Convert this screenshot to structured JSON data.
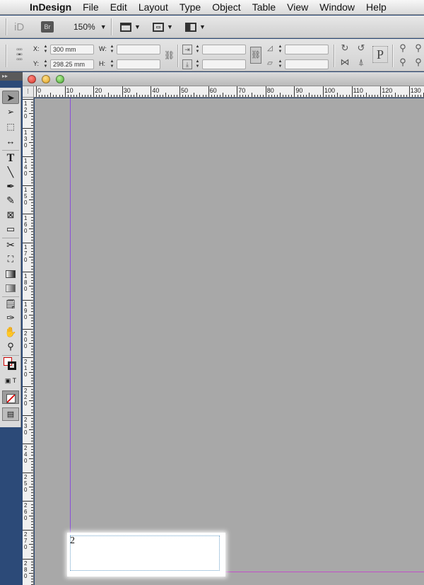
{
  "menubar": {
    "app": "InDesign",
    "items": [
      "File",
      "Edit",
      "Layout",
      "Type",
      "Object",
      "Table",
      "View",
      "Window",
      "Help"
    ]
  },
  "appbar": {
    "id_logo": "iD",
    "bridge": "Br",
    "zoom": "150%"
  },
  "control": {
    "x_label": "X:",
    "x_value": "300 mm",
    "y_label": "Y:",
    "y_value": "298.25 mm",
    "w_label": "W:",
    "h_label": "H:",
    "p_label": "P"
  },
  "panel_strip": "▸▸",
  "ruler_h": [
    "0",
    "10",
    "20",
    "30",
    "40",
    "50",
    "60",
    "70",
    "80",
    "90",
    "100",
    "110",
    "120",
    "130"
  ],
  "ruler_v": [
    "1\n2\n0",
    "1\n3\n0",
    "1\n4\n0",
    "1\n5\n0",
    "1\n6\n0",
    "1\n7\n0",
    "1\n8\n0",
    "1\n9\n0",
    "2\n0\n0",
    "2\n1\n0",
    "2\n2\n0",
    "2\n3\n0",
    "2\n4\n0",
    "2\n5\n0",
    "2\n6\n0",
    "2\n7\n0",
    "2\n8\n0"
  ],
  "document": {
    "page_number": "2"
  },
  "colors": {
    "margin_guide": "#8a4fd8",
    "bleed_guide": "#c14fc8",
    "pasteboard": "#a8a8a8"
  },
  "tools": [
    "selection-tool",
    "direct-selection-tool",
    "page-tool",
    "gap-tool",
    "type-tool",
    "line-tool",
    "pen-tool",
    "pencil-tool",
    "rectangle-frame-tool",
    "rectangle-tool",
    "scissors-tool",
    "free-transform-tool",
    "gradient-swatch-tool",
    "gradient-feather-tool",
    "note-tool",
    "eyedropper-tool",
    "hand-tool",
    "zoom-tool"
  ]
}
